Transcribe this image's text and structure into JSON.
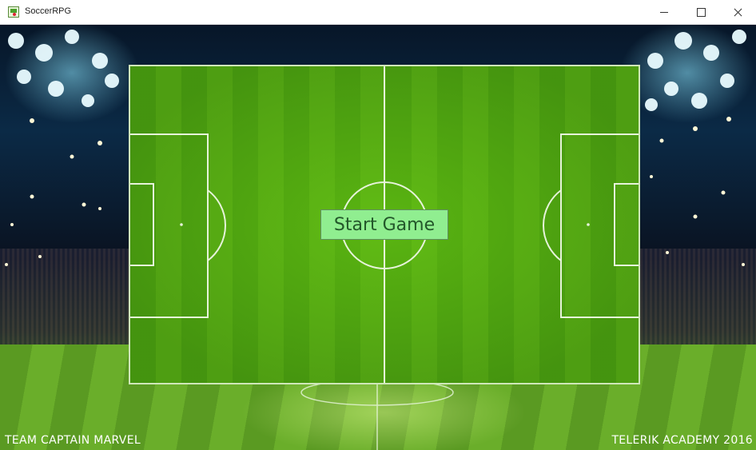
{
  "window": {
    "title": "SoccerRPG",
    "icon": "app-icon",
    "controls": [
      "minimize-icon",
      "maximize-icon",
      "close-icon"
    ]
  },
  "main": {
    "start_button_label": "Start Game"
  },
  "footer": {
    "left_text": "TEAM CAPTAIN MARVEL",
    "right_text": "TELERIK ACADEMY 2016"
  },
  "colors": {
    "button_bg": "#90ee90",
    "button_text": "#23572a",
    "pitch_green": "#4aa010",
    "line_color": "#e6f3da"
  }
}
